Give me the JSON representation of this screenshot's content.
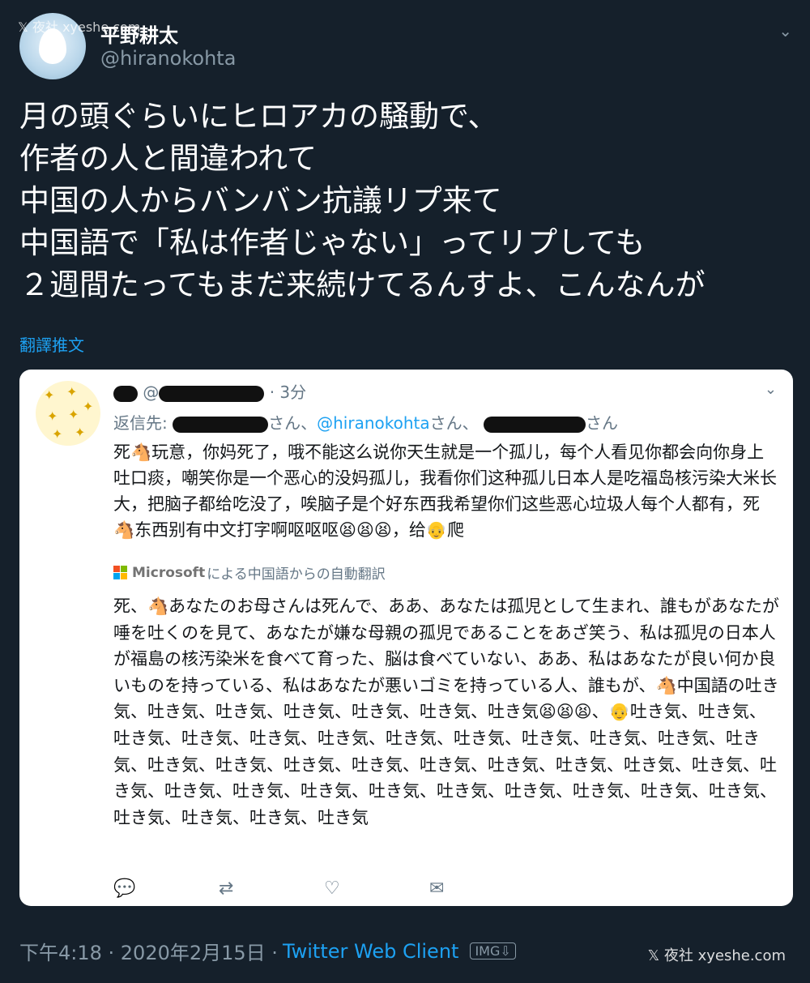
{
  "watermark": {
    "top": "𝕏 夜社 xyeshe.com",
    "bottom": "𝕏 夜社 xyeshe.com"
  },
  "tweet": {
    "display_name": "平野耕太",
    "handle": "@hiranokohta",
    "lines": [
      "月の頭ぐらいにヒロアカの騒動で、",
      "作者の人と間違われて",
      "中国の人からバンバン抗議リプ来て",
      "中国語で「私は作者じゃない」ってリプしても",
      "２週間たってもまだ来続けてるんすよ、こんなんが"
    ],
    "translate_label": "翻譯推文",
    "caret": "⌄"
  },
  "embedded": {
    "name_at": "@",
    "time": "· 3分",
    "reply_label": "返信先:",
    "reply_suffix_1": "さん、",
    "mention": "@hiranokohta",
    "reply_suffix_2": "さん、",
    "reply_suffix_3": "さん",
    "chinese_text": "死🐴玩意，你妈死了，哦不能这么说你天生就是一个孤儿，每个人看见你都会向你身上吐口痰，嘲笑你是一个恶心的没妈孤儿，我看你们这种孤儿日本人是吃福岛核污染大米长大，把脑子都给吃没了，唉脑子是个好东西我希望你们这些恶心垃圾人每个人都有，死🐴东西别有中文打字啊呕呕呕😫😫😫，给👴爬",
    "translation_brand": "Microsoft",
    "translation_label": "による中国語からの自動翻訳",
    "japanese_text": "死、🐴あなたのお母さんは死んで、ああ、あなたは孤児として生まれ、誰もがあなたが唾を吐くのを見て、あなたが嫌な母親の孤児であることをあざ笑う、私は孤児の日本人が福島の核汚染米を食べて育った、脳は食べていない、ああ、私はあなたが良い何か良いものを持っている、私はあなたが悪いゴミを持っている人、誰もが、🐴中国語の吐き気、吐き気、吐き気、吐き気、吐き気、吐き気、吐き気😫😫😫、👴吐き気、吐き気、吐き気、吐き気、吐き気、吐き気、吐き気、吐き気、吐き気、吐き気、吐き気、吐き気、吐き気、吐き気、吐き気、吐き気、吐き気、吐き気、吐き気、吐き気、吐き気、吐き気、吐き気、吐き気、吐き気、吐き気、吐き気、吐き気、吐き気、吐き気、吐き気、吐き気、吐き気、吐き気、吐き気",
    "actions": {
      "reply": "💬",
      "retweet": "⇄",
      "like": "♡",
      "share": "✉"
    }
  },
  "footer": {
    "timestamp": "下午4:18 · 2020年2月15日 ·",
    "client": "Twitter Web Client",
    "badge": "IMG⇩"
  },
  "colors": {
    "background": "#15202b",
    "link": "#1da1f2",
    "muted": "#8899a6"
  }
}
